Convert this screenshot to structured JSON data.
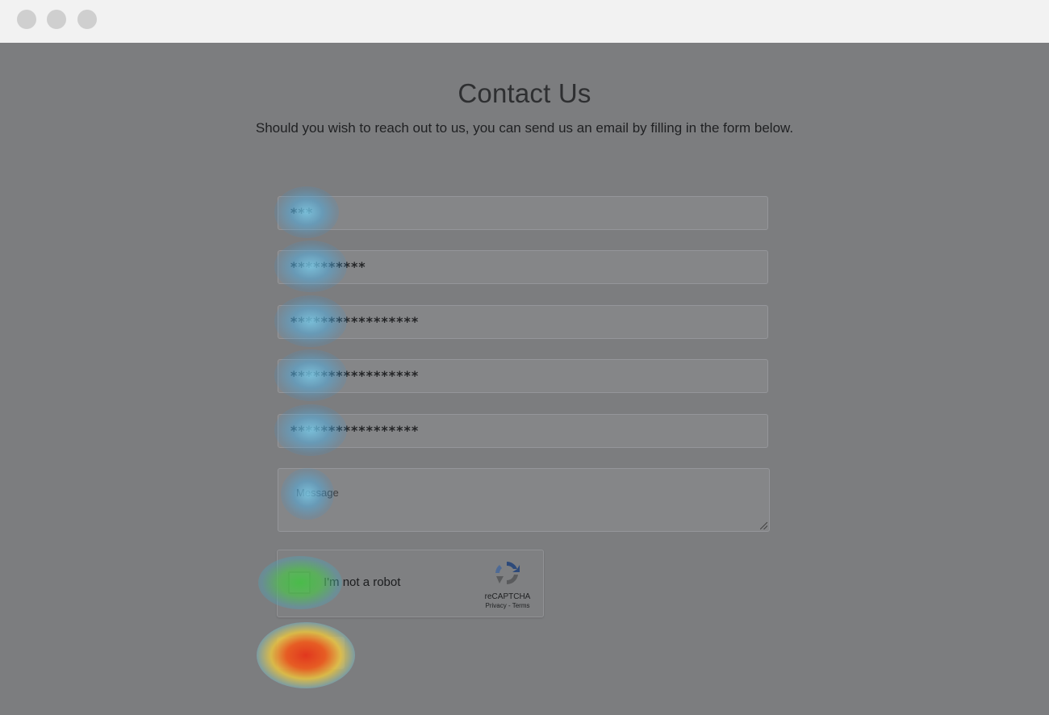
{
  "window": {
    "controls": [
      "close-dot",
      "minimize-dot",
      "maximize-dot"
    ]
  },
  "page": {
    "title": "Contact Us",
    "subtitle": "Should you wish to reach out to us, you can send us an email by filling in the form below."
  },
  "form": {
    "fields": [
      {
        "value": "***"
      },
      {
        "value": "**********"
      },
      {
        "value": "*****************"
      },
      {
        "value": "*****************"
      },
      {
        "value": "*****************"
      }
    ],
    "message_placeholder": "Message",
    "captcha": {
      "label": "I'm not a robot",
      "brand": "reCAPTCHA",
      "links": "Privacy - Terms",
      "icon": "recaptcha-logo-icon"
    },
    "submit_label": ""
  },
  "colors": {
    "titlebar": "#f2f2f2",
    "overlay": "#7c7d7f",
    "heat_hot": "#e1371e",
    "heat_mid": "#46be46",
    "heat_cool": "#78c8e6"
  }
}
